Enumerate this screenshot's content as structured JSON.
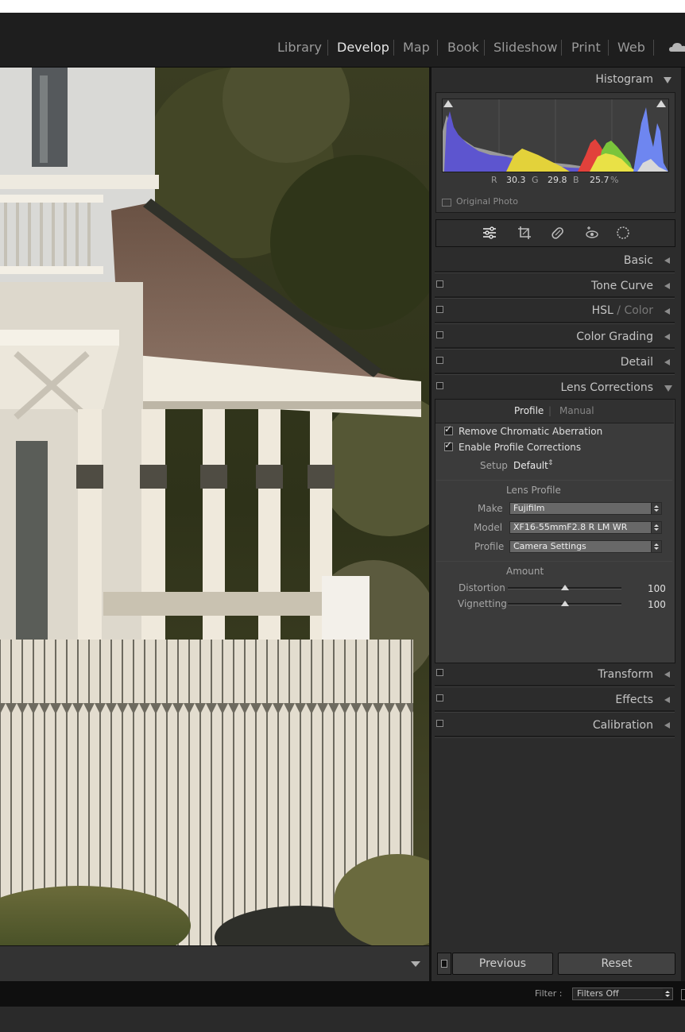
{
  "module_picker": {
    "items": [
      "Library",
      "Develop",
      "Map",
      "Book",
      "Slideshow",
      "Print",
      "Web"
    ],
    "active": "Develop",
    "cloud_icon": "cloud-icon"
  },
  "histogram": {
    "title": "Histogram",
    "r_label": "R",
    "r_value": "30.3",
    "g_label": "G",
    "g_value": "29.8",
    "b_label": "B",
    "b_value": "25.7",
    "unit": "%",
    "original_photo": "Original Photo"
  },
  "tools": [
    "sliders-icon",
    "crop-icon",
    "healing-icon",
    "red-eye-icon",
    "masking-icon"
  ],
  "panels": {
    "basic": "Basic",
    "tone_curve": "Tone Curve",
    "hsl": "HSL",
    "hsl_sep": "/",
    "color": "Color",
    "color_grading": "Color Grading",
    "detail": "Detail",
    "lens_corrections": "Lens Corrections",
    "transform": "Transform",
    "effects": "Effects",
    "calibration": "Calibration"
  },
  "lens": {
    "tab_profile": "Profile",
    "tab_sep": "|",
    "tab_manual": "Manual",
    "remove_ca": "Remove Chromatic Aberration",
    "enable_profile": "Enable Profile Corrections",
    "setup_label": "Setup",
    "setup_value": "Default",
    "lens_profile_heading": "Lens Profile",
    "make_label": "Make",
    "make_value": "Fujifilm",
    "model_label": "Model",
    "model_value": "XF16-55mmF2.8 R LM WR",
    "profile_label": "Profile",
    "profile_value": "Camera Settings",
    "amount_heading": "Amount",
    "distortion_label": "Distortion",
    "distortion_value": "100",
    "distortion_level": 0.5,
    "vignetting_label": "Vignetting",
    "vignetting_value": "100",
    "vignetting_level": 0.5
  },
  "buttons": {
    "previous": "Previous",
    "reset": "Reset"
  },
  "filter": {
    "label": "Filter :",
    "value": "Filters Off"
  },
  "colors": {
    "panel_bg": "#2c2c2c",
    "active_text": "#e6e6e6",
    "inactive_text": "#9a9a9a"
  }
}
